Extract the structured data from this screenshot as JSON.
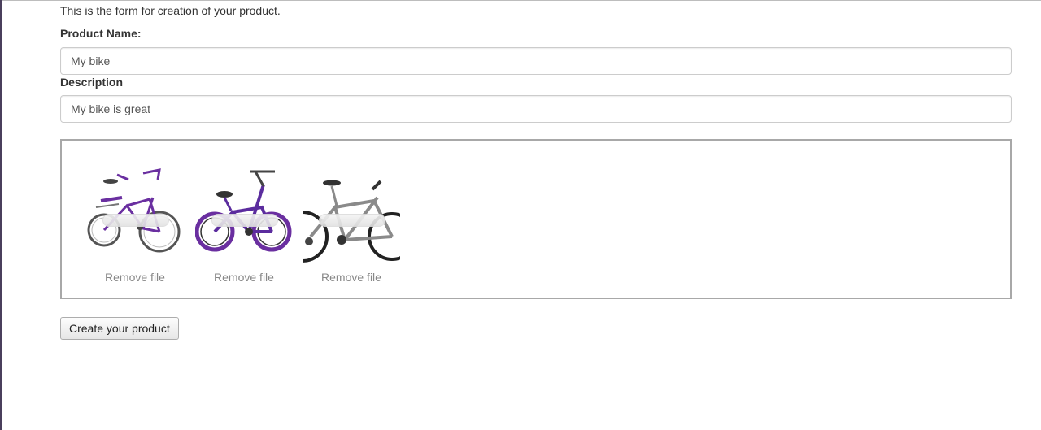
{
  "form": {
    "intro_text": "This is the form for creation of your product.",
    "product_name_label": "Product Name:",
    "product_name_value": "My bike",
    "description_label": "Description",
    "description_value": "My bike is great"
  },
  "dropzone": {
    "files": [
      {
        "remove_label": "Remove file",
        "thumbnail_icon": "purple-cruiser-bike-icon",
        "color": "#6a2fa0"
      },
      {
        "remove_label": "Remove file",
        "thumbnail_icon": "purple-bmx-bike-icon",
        "color": "#5b2c9e"
      },
      {
        "remove_label": "Remove file",
        "thumbnail_icon": "grey-mountain-bike-icon",
        "color": "#8a8a8a"
      }
    ]
  },
  "actions": {
    "create_label": "Create your product"
  }
}
